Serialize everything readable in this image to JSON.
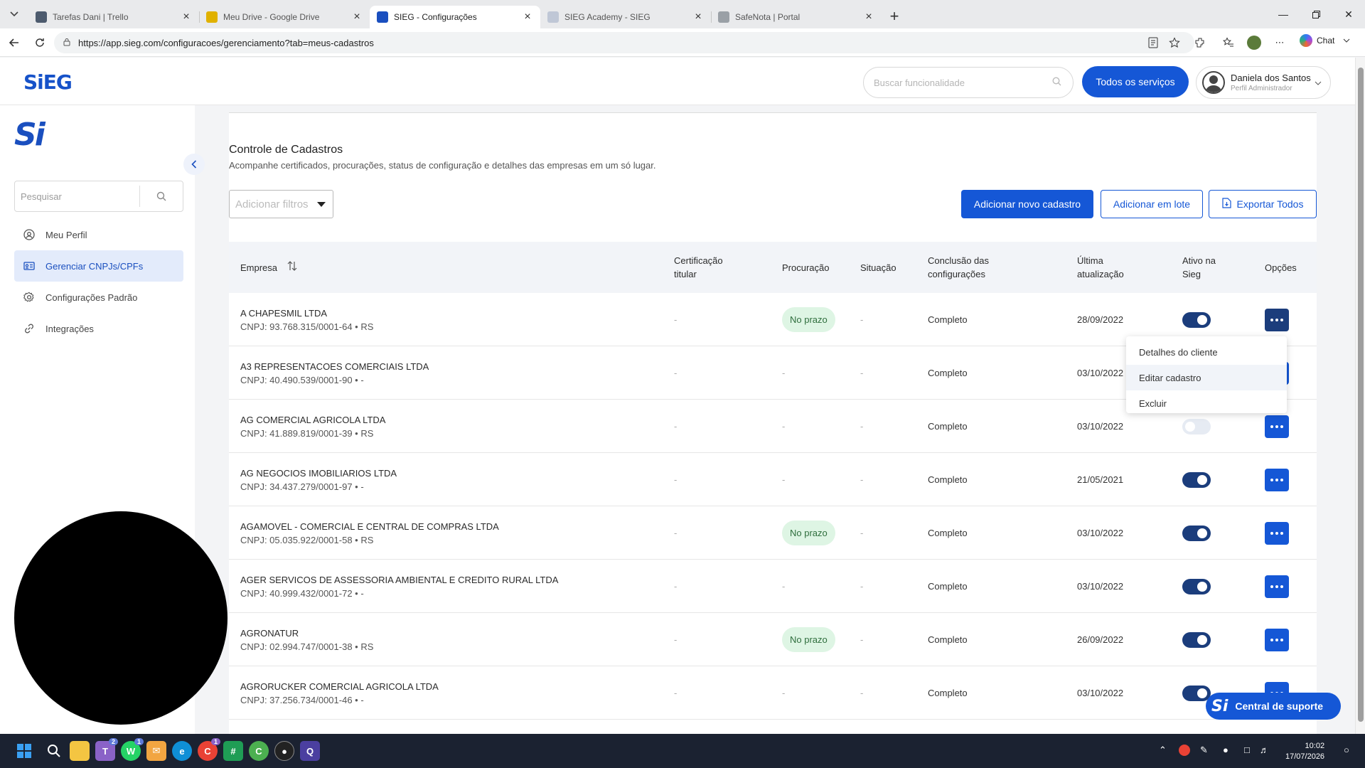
{
  "browser": {
    "tabs": [
      {
        "title": "Tarefas Dani | Trello",
        "favicon": "trello-icon",
        "color": "#4d5b6e",
        "active": false
      },
      {
        "title": "Meu Drive - Google Drive",
        "favicon": "drive-icon",
        "color": "#e0b100",
        "active": false
      },
      {
        "title": "SIEG - Configurações",
        "favicon": "sieg-icon",
        "color": "#1a4fbf",
        "active": true
      },
      {
        "title": "SIEG Academy - SIEG",
        "favicon": "sieg-icon",
        "color": "#bfc7d6",
        "active": false
      },
      {
        "title": "SafeNota | Portal",
        "favicon": "globe-icon",
        "color": "#9aa0a6",
        "active": false
      }
    ],
    "url": "https://app.sieg.com/configuracoes/gerenciamento?tab=meus-cadastros",
    "chat_label": "Chat"
  },
  "header": {
    "logo": "SiEG",
    "search_placeholder": "Buscar funcionalidade",
    "services_button": "Todos os serviços",
    "user_name": "Daniela dos Santos",
    "user_role": "Perfil Administrador"
  },
  "sidebar": {
    "logo": "Si",
    "search_placeholder": "Pesquisar",
    "items": [
      {
        "label": "Meu Perfil",
        "icon": "user-circle-icon"
      },
      {
        "label": "Gerenciar CNPJs/CPFs",
        "icon": "id-card-icon",
        "active": true
      },
      {
        "label": "Configurações Padrão",
        "icon": "gear-icon"
      },
      {
        "label": "Integrações",
        "icon": "link-icon"
      }
    ]
  },
  "page": {
    "title": "Controle de Cadastros",
    "subtitle": "Acompanhe certificados, procurações, status de configuração e detalhes das empresas em um só lugar.",
    "filter_placeholder": "Adicionar filtros",
    "btn_add": "Adicionar novo cadastro",
    "btn_batch": "Adicionar em lote",
    "btn_export": "Exportar Todos"
  },
  "table": {
    "headers": {
      "empresa": "Empresa",
      "cert_l1": "Certificação",
      "cert_l2": "titular",
      "procuracao": "Procuração",
      "situacao": "Situação",
      "conclusao_l1": "Conclusão das",
      "conclusao_l2": "configurações",
      "atualizacao_l1": "Última",
      "atualizacao_l2": "atualização",
      "ativo_l1": "Ativo na",
      "ativo_l2": "Sieg",
      "opcoes": "Opções"
    },
    "rows": [
      {
        "name": "A CHAPESMIL LTDA",
        "cnpj": "CNPJ: 93.768.315/0001-64 • RS",
        "cert": "-",
        "proc": "No prazo",
        "sit": "-",
        "concl": "Completo",
        "date": "28/09/2022",
        "ativo": true
      },
      {
        "name": "A3 REPRESENTACOES COMERCIAIS LTDA",
        "cnpj": "CNPJ: 40.490.539/0001-90 • -",
        "cert": "-",
        "proc": "-",
        "sit": "-",
        "concl": "Completo",
        "date": "03/10/2022",
        "ativo": true
      },
      {
        "name": "AG COMERCIAL AGRICOLA LTDA",
        "cnpj": "CNPJ: 41.889.819/0001-39 • RS",
        "cert": "-",
        "proc": "-",
        "sit": "-",
        "concl": "Completo",
        "date": "03/10/2022",
        "ativo": false
      },
      {
        "name": "AG NEGOCIOS IMOBILIARIOS LTDA",
        "cnpj": "CNPJ: 34.437.279/0001-97 • -",
        "cert": "-",
        "proc": "-",
        "sit": "-",
        "concl": "Completo",
        "date": "21/05/2021",
        "ativo": true
      },
      {
        "name": "AGAMOVEL - COMERCIAL E CENTRAL DE COMPRAS LTDA",
        "cnpj": "CNPJ: 05.035.922/0001-58 • RS",
        "cert": "-",
        "proc": "No prazo",
        "sit": "-",
        "concl": "Completo",
        "date": "03/10/2022",
        "ativo": true
      },
      {
        "name": "AGER SERVICOS DE ASSESSORIA AMBIENTAL E CREDITO RURAL LTDA",
        "cnpj": "CNPJ: 40.999.432/0001-72 • -",
        "cert": "-",
        "proc": "-",
        "sit": "-",
        "concl": "Completo",
        "date": "03/10/2022",
        "ativo": true
      },
      {
        "name": "AGRONATUR",
        "cnpj": "CNPJ: 02.994.747/0001-38 • RS",
        "cert": "-",
        "proc": "No prazo",
        "sit": "-",
        "concl": "Completo",
        "date": "26/09/2022",
        "ativo": true
      },
      {
        "name": "AGRORUCKER COMERCIAL AGRICOLA LTDA",
        "cnpj": "CNPJ: 37.256.734/0001-46 • -",
        "cert": "-",
        "proc": "-",
        "sit": "-",
        "concl": "Completo",
        "date": "03/10/2022",
        "ativo": true
      }
    ]
  },
  "dropdown": {
    "items": [
      "Detalhes do cliente",
      "Editar cadastro",
      "Excluir"
    ]
  },
  "support_button": "Central de suporte",
  "support_logo": "Si",
  "taskbar": {
    "time": "10:02",
    "date": "17/07/2026",
    "badges": {
      "teams": "2",
      "whatsapp": "1",
      "chrome": "1"
    }
  }
}
